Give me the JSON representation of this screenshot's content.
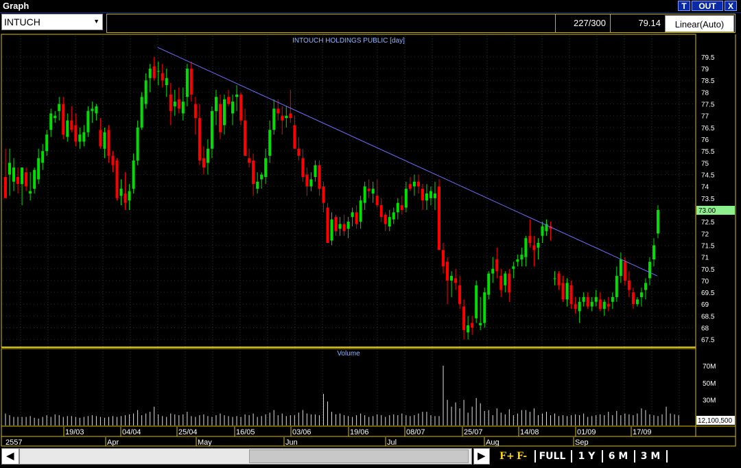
{
  "window": {
    "title": "Graph",
    "btn_t": "T",
    "btn_out": "OUT",
    "btn_x": "X"
  },
  "symbol": "INTUCH",
  "info": {
    "count": "227/300",
    "value": "79.14",
    "mode": "Linear(Auto)"
  },
  "chart_data": {
    "type": "candlestick",
    "title": "INTOUCH HOLDINGS PUBLIC [day]",
    "price_axis": {
      "ticks": [
        79.5,
        79,
        78.5,
        78,
        77.5,
        77,
        76.5,
        76,
        75.5,
        75,
        74.5,
        74,
        73.5,
        73,
        72.5,
        72,
        71.5,
        71,
        70.5,
        70,
        69.5,
        69,
        68.5,
        68,
        67.5
      ],
      "ylim": [
        67.2,
        80.4
      ]
    },
    "last_price_label": "73.00",
    "candles": [
      [
        74.4,
        75.6,
        73.5,
        73.5
      ],
      [
        74.5,
        75.6,
        73.6,
        75.0
      ],
      [
        74.2,
        75.2,
        73.8,
        74.8
      ],
      [
        74.4,
        74.8,
        73.7,
        74.1
      ],
      [
        74.1,
        74.8,
        73.2,
        74.8
      ],
      [
        74.6,
        74.8,
        73.8,
        74.0
      ],
      [
        73.7,
        74.6,
        73.4,
        73.8
      ],
      [
        73.9,
        74.8,
        73.7,
        74.7
      ],
      [
        74.3,
        75.6,
        74.1,
        75.2
      ],
      [
        75.0,
        75.8,
        74.7,
        75.5
      ],
      [
        75.5,
        76.4,
        75.3,
        76.2
      ],
      [
        76.4,
        77.3,
        76.1,
        77.1
      ],
      [
        76.9,
        77.2,
        76.7,
        77.0
      ],
      [
        77.2,
        77.8,
        76.8,
        77.5
      ],
      [
        77.5,
        77.8,
        76.0,
        76.2
      ],
      [
        76.1,
        77.1,
        75.9,
        76.8
      ],
      [
        76.8,
        77.4,
        76.3,
        76.4
      ],
      [
        76.6,
        77.1,
        75.7,
        75.9
      ],
      [
        75.9,
        76.5,
        75.6,
        76.2
      ],
      [
        75.9,
        76.6,
        75.7,
        76.3
      ],
      [
        76.3,
        77.4,
        76.1,
        77.2
      ],
      [
        77.2,
        77.6,
        76.7,
        77.3
      ],
      [
        77.1,
        77.5,
        76.8,
        77.4
      ],
      [
        76.4,
        76.9,
        75.6,
        75.7
      ],
      [
        75.6,
        76.5,
        75.2,
        76.3
      ],
      [
        76.4,
        76.6,
        75.0,
        75.3
      ],
      [
        75.3,
        75.5,
        74.6,
        74.9
      ],
      [
        75.1,
        75.2,
        73.4,
        73.5
      ],
      [
        73.6,
        74.3,
        73.2,
        73.9
      ],
      [
        73.7,
        74.6,
        73.0,
        73.3
      ],
      [
        73.4,
        74.1,
        73.0,
        73.8
      ],
      [
        73.9,
        75.4,
        73.7,
        75.1
      ],
      [
        75.1,
        76.8,
        74.9,
        76.5
      ],
      [
        76.5,
        78.0,
        76.4,
        77.8
      ],
      [
        77.5,
        78.8,
        77.3,
        78.5
      ],
      [
        78.6,
        79.2,
        78.0,
        79.0
      ],
      [
        79.1,
        79.5,
        78.5,
        78.6
      ],
      [
        78.9,
        79.3,
        78.3,
        78.9
      ],
      [
        78.8,
        79.2,
        78.2,
        78.5
      ],
      [
        78.3,
        79.0,
        77.8,
        78.6
      ],
      [
        77.9,
        78.4,
        76.6,
        77.2
      ],
      [
        77.4,
        78.1,
        77.0,
        77.6
      ],
      [
        77.7,
        78.2,
        77.1,
        77.3
      ],
      [
        77.1,
        78.2,
        76.8,
        77.6
      ],
      [
        77.8,
        79.2,
        77.4,
        79.0
      ],
      [
        79.0,
        79.3,
        77.6,
        77.9
      ],
      [
        77.5,
        77.8,
        76.2,
        76.9
      ],
      [
        76.9,
        77.5,
        74.9,
        75.1
      ],
      [
        75.2,
        75.7,
        74.5,
        74.8
      ],
      [
        75.0,
        76.0,
        74.5,
        75.6
      ],
      [
        75.6,
        77.4,
        75.2,
        77.2
      ],
      [
        77.2,
        78.1,
        76.6,
        77.8
      ],
      [
        77.5,
        77.9,
        76.0,
        76.3
      ],
      [
        76.6,
        77.9,
        76.2,
        77.7
      ],
      [
        77.8,
        78.1,
        77.4,
        77.5
      ],
      [
        77.1,
        77.9,
        76.6,
        77.6
      ],
      [
        77.8,
        78.3,
        77.2,
        77.9
      ],
      [
        77.9,
        78.0,
        76.6,
        76.8
      ],
      [
        76.8,
        77.3,
        75.4,
        75.3
      ],
      [
        75.2,
        75.6,
        74.8,
        75.0
      ],
      [
        75.1,
        75.4,
        73.6,
        74.1
      ],
      [
        73.9,
        74.6,
        73.7,
        74.2
      ],
      [
        74.3,
        74.6,
        73.9,
        74.5
      ],
      [
        74.4,
        75.6,
        74.1,
        75.2
      ],
      [
        75.3,
        76.8,
        75.0,
        76.4
      ],
      [
        76.4,
        77.7,
        76.2,
        77.3
      ],
      [
        77.3,
        77.7,
        76.8,
        77.1
      ],
      [
        77.0,
        77.4,
        76.2,
        76.8
      ],
      [
        76.9,
        77.4,
        76.5,
        77.0
      ],
      [
        77.1,
        78.1,
        76.7,
        76.9
      ],
      [
        76.6,
        77.0,
        75.8,
        75.6
      ],
      [
        75.6,
        76.1,
        75.1,
        75.3
      ],
      [
        75.2,
        75.6,
        74.2,
        74.4
      ],
      [
        74.5,
        74.8,
        73.6,
        74.0
      ],
      [
        74.0,
        74.6,
        73.8,
        74.3
      ],
      [
        74.4,
        75.1,
        74.2,
        74.9
      ],
      [
        74.9,
        75.1,
        73.6,
        73.9
      ],
      [
        74.0,
        74.2,
        72.9,
        73.3
      ],
      [
        73.1,
        73.3,
        71.6,
        71.6
      ],
      [
        71.7,
        72.9,
        71.5,
        72.6
      ],
      [
        72.7,
        72.8,
        71.9,
        72.1
      ],
      [
        72.2,
        72.7,
        71.9,
        72.4
      ],
      [
        72.4,
        72.8,
        71.9,
        72.1
      ],
      [
        72.2,
        72.7,
        71.8,
        72.5
      ],
      [
        72.7,
        73.1,
        72.3,
        72.9
      ],
      [
        72.9,
        73.2,
        72.2,
        72.4
      ],
      [
        72.5,
        73.6,
        72.2,
        73.4
      ],
      [
        73.3,
        74.2,
        73.0,
        74.0
      ],
      [
        73.9,
        74.3,
        73.5,
        73.8
      ],
      [
        73.7,
        74.2,
        73.3,
        73.9
      ],
      [
        73.6,
        74.3,
        73.1,
        73.2
      ],
      [
        73.2,
        73.5,
        72.5,
        72.7
      ],
      [
        72.8,
        72.9,
        72.1,
        72.4
      ],
      [
        72.3,
        73.0,
        72.1,
        72.7
      ],
      [
        72.6,
        73.1,
        72.4,
        72.9
      ],
      [
        72.9,
        73.5,
        72.6,
        73.3
      ],
      [
        73.2,
        73.6,
        72.8,
        73.0
      ],
      [
        73.1,
        74.2,
        72.9,
        73.9
      ],
      [
        74.1,
        74.4,
        73.8,
        73.9
      ],
      [
        74.0,
        74.5,
        73.6,
        74.2
      ],
      [
        74.2,
        74.5,
        73.7,
        74.0
      ],
      [
        73.9,
        74.1,
        73.0,
        73.4
      ],
      [
        73.4,
        74.1,
        73.0,
        73.7
      ],
      [
        73.5,
        74.0,
        73.2,
        73.8
      ],
      [
        73.5,
        74.2,
        73.0,
        73.7
      ],
      [
        74.0,
        74.3,
        73.0,
        71.3
      ],
      [
        71.3,
        71.6,
        70.3,
        70.6
      ],
      [
        70.8,
        71.0,
        69.0,
        70.0
      ],
      [
        70.0,
        70.4,
        69.3,
        70.2
      ],
      [
        70.1,
        70.5,
        69.6,
        69.9
      ],
      [
        69.8,
        70.2,
        68.8,
        69.0
      ],
      [
        68.9,
        69.2,
        67.5,
        67.9
      ],
      [
        67.8,
        68.5,
        67.5,
        68.1
      ],
      [
        68.2,
        68.5,
        67.7,
        68.0
      ],
      [
        68.4,
        70.0,
        68.2,
        69.8
      ],
      [
        68.1,
        69.3,
        67.9,
        68.2
      ],
      [
        68.2,
        69.7,
        68.0,
        69.5
      ],
      [
        69.4,
        70.4,
        69.2,
        70.3
      ],
      [
        70.3,
        71.0,
        69.9,
        70.5
      ],
      [
        70.9,
        71.4,
        70.1,
        70.4
      ],
      [
        70.2,
        70.5,
        69.3,
        69.6
      ],
      [
        69.8,
        70.4,
        69.5,
        70.3
      ],
      [
        70.3,
        70.5,
        69.1,
        69.5
      ],
      [
        70.5,
        70.8,
        70.1,
        70.6
      ],
      [
        70.8,
        71.1,
        70.6,
        70.9
      ],
      [
        70.9,
        71.4,
        70.6,
        71.1
      ],
      [
        71.0,
        71.9,
        70.6,
        71.8
      ],
      [
        71.9,
        72.6,
        71.4,
        71.6
      ],
      [
        71.5,
        71.9,
        70.6,
        71.3
      ],
      [
        71.4,
        71.8,
        70.9,
        71.6
      ],
      [
        71.9,
        72.5,
        71.6,
        72.3
      ],
      [
        72.1,
        72.6,
        71.9,
        72.4
      ],
      [
        72.3,
        72.5,
        71.7,
        72.2
      ],
      [
        70.1,
        70.4,
        69.8,
        70.1
      ],
      [
        70.3,
        70.4,
        69.6,
        69.8
      ],
      [
        69.9,
        70.2,
        69.1,
        69.2
      ],
      [
        69.2,
        70.1,
        68.9,
        69.9
      ],
      [
        69.8,
        70.0,
        68.8,
        69.0
      ],
      [
        69.0,
        69.3,
        68.6,
        68.8
      ],
      [
        68.7,
        69.3,
        68.2,
        69.1
      ],
      [
        69.1,
        69.5,
        68.9,
        69.3
      ],
      [
        69.3,
        69.5,
        68.8,
        68.9
      ],
      [
        68.9,
        69.3,
        68.7,
        69.1
      ],
      [
        69.1,
        69.6,
        68.9,
        69.3
      ],
      [
        69.2,
        69.5,
        68.7,
        68.8
      ],
      [
        68.8,
        69.2,
        68.5,
        69.1
      ],
      [
        69.0,
        69.3,
        68.7,
        68.9
      ],
      [
        69.1,
        69.5,
        68.8,
        69.3
      ],
      [
        69.3,
        70.6,
        69.1,
        70.2
      ],
      [
        70.2,
        71.2,
        69.9,
        70.9
      ],
      [
        70.8,
        71.0,
        69.8,
        70.0
      ],
      [
        70.0,
        70.4,
        69.3,
        69.6
      ],
      [
        69.5,
        69.7,
        68.8,
        69.0
      ],
      [
        69.0,
        69.3,
        68.9,
        69.2
      ],
      [
        69.3,
        69.7,
        68.9,
        69.5
      ],
      [
        69.6,
        70.1,
        69.2,
        69.9
      ],
      [
        70.1,
        71.0,
        69.8,
        70.8
      ],
      [
        70.9,
        71.8,
        70.6,
        71.5
      ],
      [
        72.0,
        73.2,
        71.8,
        73.0
      ]
    ],
    "trendline": {
      "from": [
        79.9,
        0
      ],
      "to": [
        70.2,
        160
      ]
    },
    "volume": {
      "title": "Volume",
      "ticks": [
        "70M",
        "50M",
        "30M"
      ],
      "ylim": [
        0,
        90
      ],
      "last_label": "12,100,500",
      "values": [
        14,
        12,
        10,
        10,
        10,
        10,
        11,
        9,
        8,
        10,
        12,
        10,
        13,
        12,
        10,
        11,
        11,
        10,
        9,
        10,
        11,
        12,
        11,
        10,
        9,
        10,
        11,
        10,
        11,
        12,
        13,
        14,
        18,
        12,
        14,
        16,
        22,
        13,
        11,
        10,
        14,
        13,
        12,
        13,
        16,
        11,
        10,
        12,
        13,
        11,
        10,
        12,
        14,
        12,
        11,
        10,
        11,
        10,
        13,
        12,
        14,
        10,
        11,
        13,
        15,
        18,
        12,
        14,
        11,
        12,
        12,
        15,
        18,
        14,
        13,
        13,
        12,
        37,
        28,
        16,
        13,
        14,
        12,
        11,
        10,
        12,
        14,
        12,
        10,
        11,
        13,
        12,
        10,
        12,
        13,
        12,
        14,
        12,
        11,
        12,
        14,
        16,
        16,
        12,
        11,
        11,
        70,
        30,
        22,
        27,
        20,
        30,
        15,
        22,
        32,
        26,
        17,
        18,
        12,
        20,
        15,
        13,
        19,
        12,
        14,
        18,
        18,
        16,
        20,
        12,
        14,
        16,
        12,
        14,
        11,
        12,
        11,
        12,
        13,
        12,
        14,
        10,
        11,
        12,
        13,
        12,
        16,
        12,
        17,
        12,
        14,
        13,
        12,
        14,
        20,
        18,
        13,
        12,
        11,
        13,
        22,
        14,
        13,
        12
      ],
      "dates_note": ""
    },
    "x_dates": [
      "19/03",
      "04/04",
      "25/04",
      "16/05",
      "03/06",
      "19/06",
      "08/07",
      "25/07",
      "14/08",
      "01/09",
      "17/09"
    ],
    "x_months": [
      "2557",
      "Apr",
      "May",
      "Jun",
      "Jul",
      "Aug",
      "Sep"
    ]
  },
  "bottom": {
    "f_plus": "F+",
    "f_minus": "F-",
    "full": "FULL",
    "y1": "1 Y",
    "m6": "6 M",
    "m3": "3 M"
  },
  "colors": {
    "up": "#00e000",
    "down": "#ff0000",
    "axis": "#d8c000",
    "trend": "#7070ff",
    "label": "#8fb6ff"
  }
}
